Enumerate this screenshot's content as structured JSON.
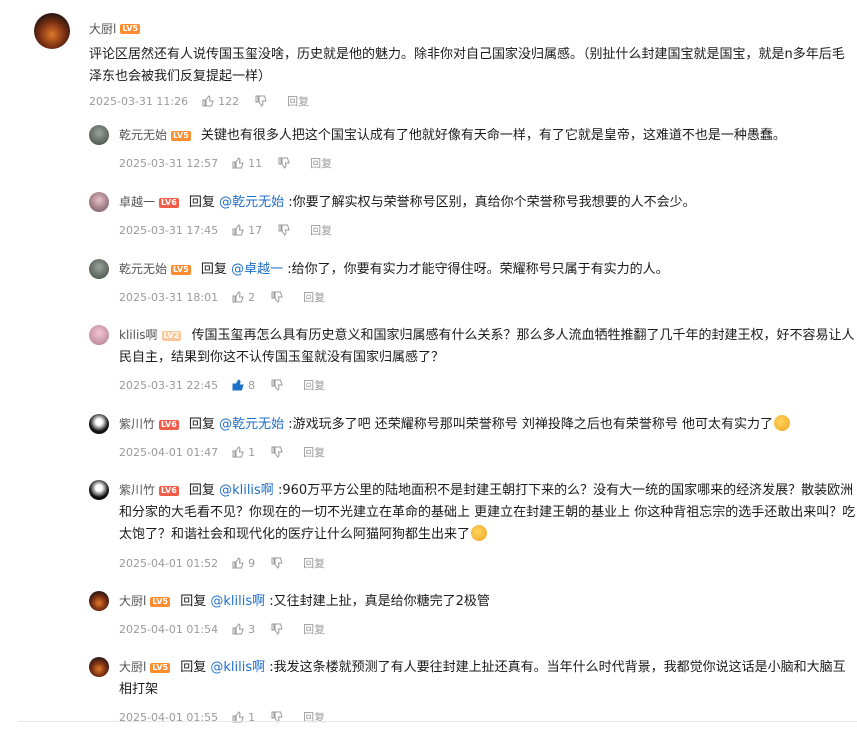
{
  "root": {
    "name": "大厨l",
    "level": "LV5",
    "text": "评论区居然还有人说传国玉玺没啥，历史就是他的魅力。除非你对自己国家没归属感。（别扯什么封建国宝就是国宝，就是n多年后毛泽东也会被我们反复提起一样）",
    "time": "2025-03-31 11:26",
    "likes": "122",
    "reply_label": "回复"
  },
  "replies": [
    {
      "name": "乾元无始",
      "level": "LV5",
      "prefix": "",
      "at": "",
      "text": "关键也有很多人把这个国宝认成有了他就好像有天命一样，有了它就是皇帝，这难道不也是一种愚蠢。",
      "time": "2025-03-31 12:57",
      "likes": "11",
      "reply_label": "回复"
    },
    {
      "name": "卓越一",
      "level": "LV6",
      "prefix": "回复 ",
      "at": "@乾元无始",
      "text": " :你要了解实权与荣誉称号区别，真给你个荣誉称号我想要的人不会少。",
      "time": "2025-03-31 17:45",
      "likes": "17",
      "reply_label": "回复"
    },
    {
      "name": "乾元无始",
      "level": "LV5",
      "prefix": "回复 ",
      "at": "@卓越一",
      "text": " :给你了，你要有实力才能守得住呀。荣耀称号只属于有实力的人。",
      "time": "2025-03-31 18:01",
      "likes": "2",
      "reply_label": "回复"
    },
    {
      "name": "klilis啊",
      "level": "LV2",
      "prefix": "",
      "at": "",
      "text": "传国玉玺再怎么具有历史意义和国家归属感有什么关系？那么多人流血牺牲推翻了几千年的封建王权，好不容易让人民自主，结果到你这不认传国玉玺就没有国家归属感了？",
      "time": "2025-03-31 22:45",
      "likes": "8",
      "reply_label": "回复"
    },
    {
      "name": "紫川竹",
      "level": "LV6",
      "prefix": "回复 ",
      "at": "@乾元无始",
      "text": " :游戏玩多了吧 还荣耀称号那叫荣誉称号 刘禅投降之后也有荣誉称号 他可太有实力了",
      "time": "2025-04-01 01:47",
      "likes": "1",
      "reply_label": "回复"
    },
    {
      "name": "紫川竹",
      "level": "LV6",
      "prefix": "回复 ",
      "at": "@klilis啊",
      "text": " :960万平方公里的陆地面积不是封建王朝打下来的么？没有大一统的国家哪来的经济发展？散装欧洲和分家的大毛看不见？你现在的一切不光建立在革命的基础上 更建立在封建王朝的基业上 你这种背祖忘宗的选手还敢出来叫？吃太饱了？和谐社会和现代化的医疗让什么阿猫阿狗都生出来了",
      "time": "2025-04-01 01:52",
      "likes": "9",
      "reply_label": "回复"
    },
    {
      "name": "大厨l",
      "level": "LV5",
      "prefix": "回复 ",
      "at": "@klilis啊",
      "text": " :又往封建上扯，真是给你糖完了2极管",
      "time": "2025-04-01 01:54",
      "likes": "3",
      "reply_label": "回复"
    },
    {
      "name": "大厨l",
      "level": "LV5",
      "prefix": "回复 ",
      "at": "@klilis啊",
      "text": " :我发这条楼就预测了有人要往封建上扯还真有。当年什么时代背景，我都觉你说这话是小脑和大脑互相打架",
      "time": "2025-04-01 01:55",
      "likes": "1",
      "reply_label": "回复"
    }
  ],
  "colors": {
    "accent": "#1e6fc7",
    "level5": "#ff8c2e",
    "level6": "#f25d4a",
    "liked": "#1e6fc7"
  }
}
